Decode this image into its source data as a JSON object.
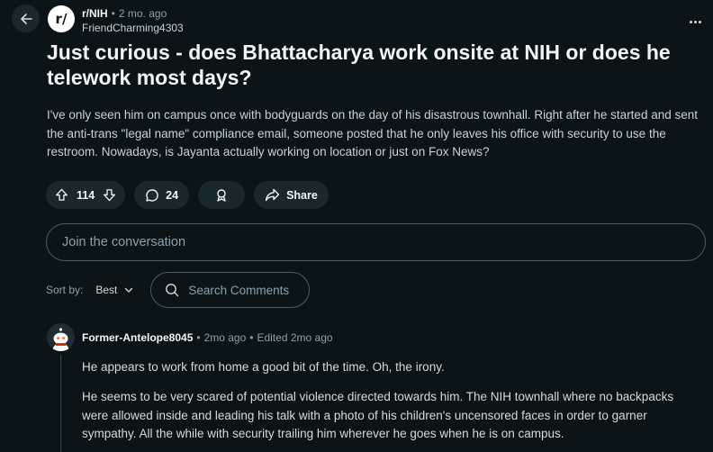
{
  "post": {
    "subreddit_icon_text": "r/",
    "subreddit": "r/NIH",
    "separator": "•",
    "time": "2 mo. ago",
    "author": "FriendCharming4303",
    "title": "Just curious - does Bhattacharya work onsite at NIH or does he telework most days?",
    "body": "I've only seen him on campus once with bodyguards on the day of his disastrous townhall. Right after he started and sent the anti-trans \"legal name\" compliance email, someone posted that he only leaves his office with security to use the restroom. Nowadays, is Jayanta actually working on location or just on Fox News?"
  },
  "actions": {
    "vote_count": "114",
    "comment_count": "24",
    "share_label": "Share"
  },
  "comment_box": {
    "placeholder": "Join the conversation"
  },
  "sort": {
    "label": "Sort by:",
    "value": "Best",
    "search_placeholder": "Search Comments"
  },
  "comments": [
    {
      "author": "Former-Antelope8045",
      "separator": "•",
      "time": "2mo ago",
      "edited": "Edited 2mo ago",
      "paragraphs": [
        "He appears to work from home a good bit of the time. Oh, the irony.",
        "He seems to be very scared of potential violence directed towards him. The NIH townhall where no backpacks were allowed inside and leading his talk with a photo of his children's uncensored faces in order to garner sympathy. All the while with security trailing him wherever he goes when he is on campus."
      ]
    }
  ],
  "icons": [
    "arrow-left-icon",
    "subreddit-icon",
    "more-icon",
    "upvote-icon",
    "downvote-icon",
    "comment-icon",
    "award-icon",
    "share-icon",
    "chevron-down-icon",
    "search-icon",
    "avatar-icon"
  ],
  "colors": {
    "background": "#0b1416",
    "pill": "#1a282d",
    "border": "#4b5e66",
    "muted_text": "#8ba2ad"
  }
}
